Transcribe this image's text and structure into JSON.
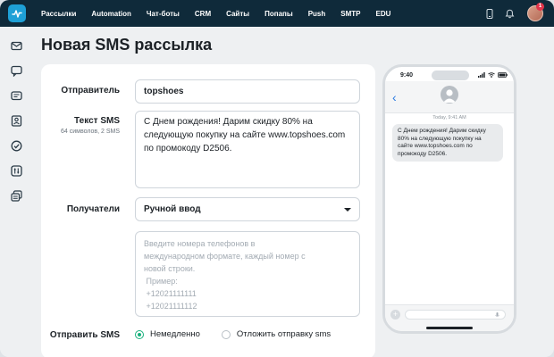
{
  "nav": {
    "items": [
      "Рассылки",
      "Automation",
      "Чат-боты",
      "CRM",
      "Сайты",
      "Попапы",
      "Push",
      "SMTP",
      "EDU"
    ]
  },
  "top": {
    "notification_count": "1"
  },
  "page": {
    "title": "Новая SMS рассылка"
  },
  "form": {
    "sender_label": "Отправитель",
    "sender_value": "topshoes",
    "text_label": "Текст SMS",
    "text_counter": "64 символов, 2 SMS",
    "text_value": "С Днем рождения! Дарим скидку 80% на следующую покупку на сайте www.topshoes.com по промокоду D2506.",
    "recipients_label": "Получатели",
    "recipients_selected": "Ручной ввод",
    "phones_placeholder_lines": [
      "Введите номера телефонов в",
      "международном формате, каждый номер с",
      "новой строки.",
      " Пример:",
      " +12021111111",
      " +12021111112"
    ],
    "send_label": "Отправить SMS",
    "send_now": "Немедленно",
    "send_later": "Отложить отправку sms",
    "send_selected": "now"
  },
  "preview": {
    "time": "9:40",
    "message_time": "Today, 9:41 AM",
    "message": "С Днем рождения! Дарим скидку 80% на следующую покупку на сайте www.topshoes.com по промокоду D2506."
  },
  "colors": {
    "topbar": "#0f2a3a",
    "accent": "#18b07c",
    "badge": "#e0344a",
    "ios_blue": "#2a7ae2"
  }
}
